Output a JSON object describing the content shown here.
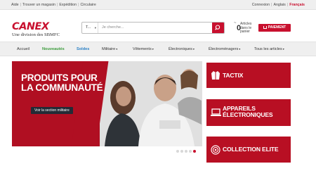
{
  "topbar": {
    "left": [
      "Aide",
      "Trouver un magasin",
      "Expédition",
      "Circulaire"
    ],
    "separator": "|",
    "login": "Connexion",
    "lang_en": "Anglais",
    "lang_fr": "Français"
  },
  "logo": {
    "wordmark": "CANEX",
    "tagline": "Une division des SBMFC"
  },
  "search": {
    "category": "T...",
    "placeholder": "Je cherche..."
  },
  "cart": {
    "count": "0",
    "label": "Articles dans le panier"
  },
  "payment_button": "PAIEMENT",
  "nav": {
    "items": [
      {
        "label": "Accueil"
      },
      {
        "label": "Nouveautés"
      },
      {
        "label": "Soldes"
      },
      {
        "label": "Militaire"
      },
      {
        "label": "Vêtements"
      },
      {
        "label": "Électroniques"
      },
      {
        "label": "Électroménagers"
      },
      {
        "label": "Tous les articles"
      }
    ],
    "dropdown_glyph": "▾"
  },
  "hero": {
    "title": "PRODUITS POUR LA COMMUNAUTÉ",
    "cta": "Voir la section militaire",
    "slides": 5,
    "active_slide": 5
  },
  "promos": [
    {
      "label": "TACTIX",
      "icon": "jacket-icon"
    },
    {
      "label": "APPAREILS ÉLECTRONIQUES",
      "icon": "laptop-icon"
    },
    {
      "label": "COLLECTION ELITE",
      "icon": "badge-icon"
    }
  ],
  "colors": {
    "brand_red": "#c8102e",
    "nav_green": "#3b9b3b",
    "nav_blue": "#2a7fc5",
    "cta_dark": "#232b36"
  }
}
